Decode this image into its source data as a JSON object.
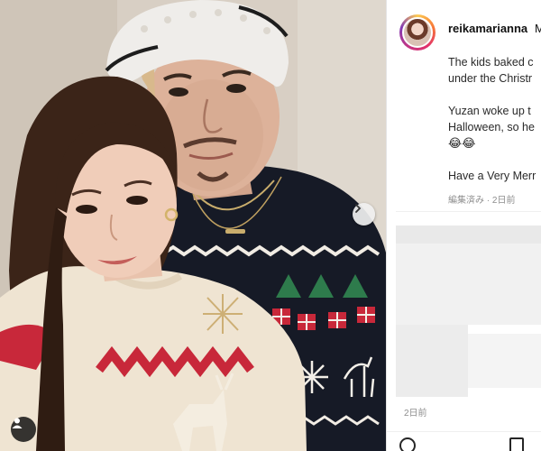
{
  "post": {
    "username": "reikamarianna",
    "username_tail": "M",
    "caption": [
      "The kids baked c",
      "under the Christr",
      "Yuzan woke up t",
      "Halloween, so he"
    ],
    "emoji_line": "😂😂",
    "closing_line": "Have a Very Merr",
    "meta": "編集済み · 2日前",
    "comment_time": "2日前"
  },
  "icons": {
    "next": "chevron-right-icon",
    "tag": "user-icon",
    "comment": "comment-icon",
    "save": "bookmark-icon"
  },
  "colors": {
    "sweater_dark": "#161a26",
    "sweater_red": "#c8283a",
    "sweater_cream": "#efe4d2",
    "beanie": "#efedea",
    "wall": "#d8cfc4",
    "meta_gray": "#8e8e8e"
  }
}
